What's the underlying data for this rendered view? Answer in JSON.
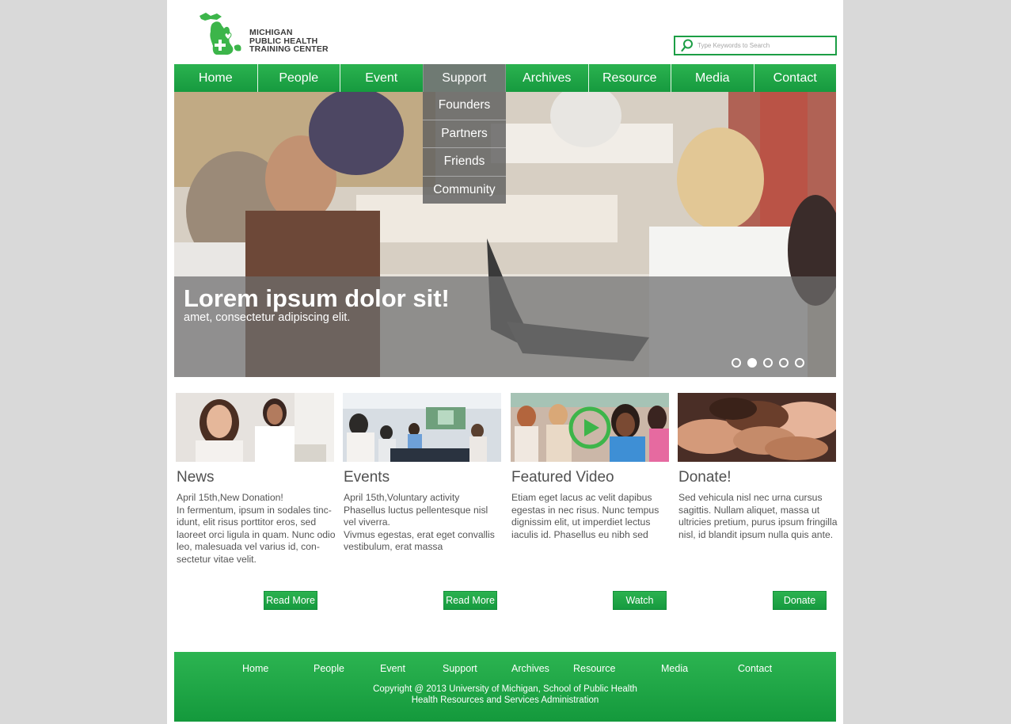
{
  "colors": {
    "brand_green": "#1c9e45",
    "background": "#d9d9d9"
  },
  "logo": {
    "lines": [
      "MICHIGAN",
      "PUBLIC HEALTH",
      "TRAINING CENTER"
    ],
    "icon": "michigan-map-logo-icon"
  },
  "search": {
    "placeholder": "Type Keywords to Search",
    "icon": "search-icon"
  },
  "nav": {
    "items": [
      "Home",
      "People",
      "Event",
      "Support",
      "Archives",
      "Resource",
      "Media",
      "Contact"
    ],
    "active": "Support",
    "dropdown": [
      "Founders",
      "Partners",
      "Friends",
      "Community"
    ]
  },
  "hero": {
    "title": "Lorem ipsum dolor sit!",
    "subtitle": "amet, consectetur adipiscing elit.",
    "slides": 5,
    "active_slide": 2
  },
  "cards": [
    {
      "title": "News",
      "lines": [
        "April 15th,New Donation!",
        "In fermentum, ipsum in sodales tinc-",
        "idunt, elit risus porttitor eros, sed",
        "laoreet orci ligula in quam. Nunc odio",
        "leo, malesuada vel varius id, con-",
        "sectetur vitae velit."
      ],
      "button": "Read More"
    },
    {
      "title": "Events",
      "lines": [
        "April 15th,Voluntary activity",
        "Phasellus luctus pellentesque nisl",
        "vel viverra.",
        "Vivmus egestas, erat eget convallis",
        "vestibulum, erat massa"
      ],
      "button": "Read More"
    },
    {
      "title": "Featured Video",
      "lines": [
        "Etiam eget lacus ac velit dapibus",
        "egestas in nec risus. Nunc tempus",
        "dignissim elit, ut imperdiet lectus",
        "iaculis id. Phasellus eu nibh sed"
      ],
      "button": "Watch"
    },
    {
      "title": "Donate!",
      "lines": [
        "Sed vehicula nisl nec urna cursus",
        "sagittis. Nullam aliquet, massa ut",
        "ultricies pretium, purus ipsum fringilla",
        "nisl, id blandit ipsum nulla quis ante."
      ],
      "button": "Donate"
    }
  ],
  "footer": {
    "links": [
      "Home",
      "People",
      "Event",
      "Support",
      "Archives",
      "Resource",
      "Media",
      "Contact"
    ],
    "copyright": "Copyright @ 2013 University of Michigan, School of Public Health",
    "org": "Health Resources and Services Administration"
  }
}
